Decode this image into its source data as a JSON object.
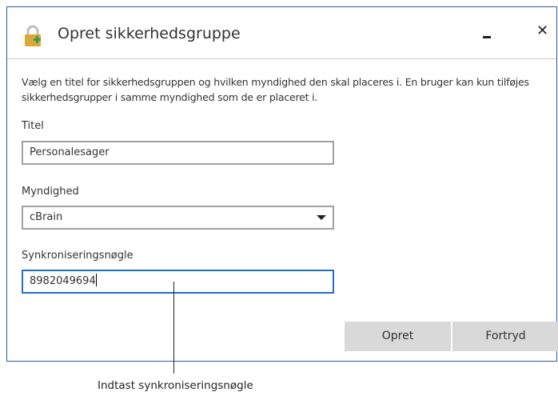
{
  "window": {
    "title": "Opret sikkerhedsgruppe",
    "icon": "lock-plus-icon",
    "minimize_icon": "minimize-icon",
    "close_glyph": "✕"
  },
  "description": "Vælg en titel for sikkerhedsgruppen og hvilken myndighed den skal placeres i. En bruger kan kun tilføjes sikkerhedsgrupper i samme myndighed som de er placeret i.",
  "fields": {
    "title_label": "Titel",
    "title_value": "Personalesager",
    "authority_label": "Myndighed",
    "authority_value": "cBrain",
    "sync_label": "Synkroniseringsnøgle",
    "sync_value": "8982049694"
  },
  "buttons": {
    "create": "Opret",
    "cancel": "Fortryd"
  },
  "callout": "Indtast synkroniseringsnøgle",
  "colors": {
    "accent": "#1e6fd0",
    "lock_body": "#d9a93a",
    "lock_plus": "#3c9a4e",
    "button_bg": "#d9d9d9"
  }
}
